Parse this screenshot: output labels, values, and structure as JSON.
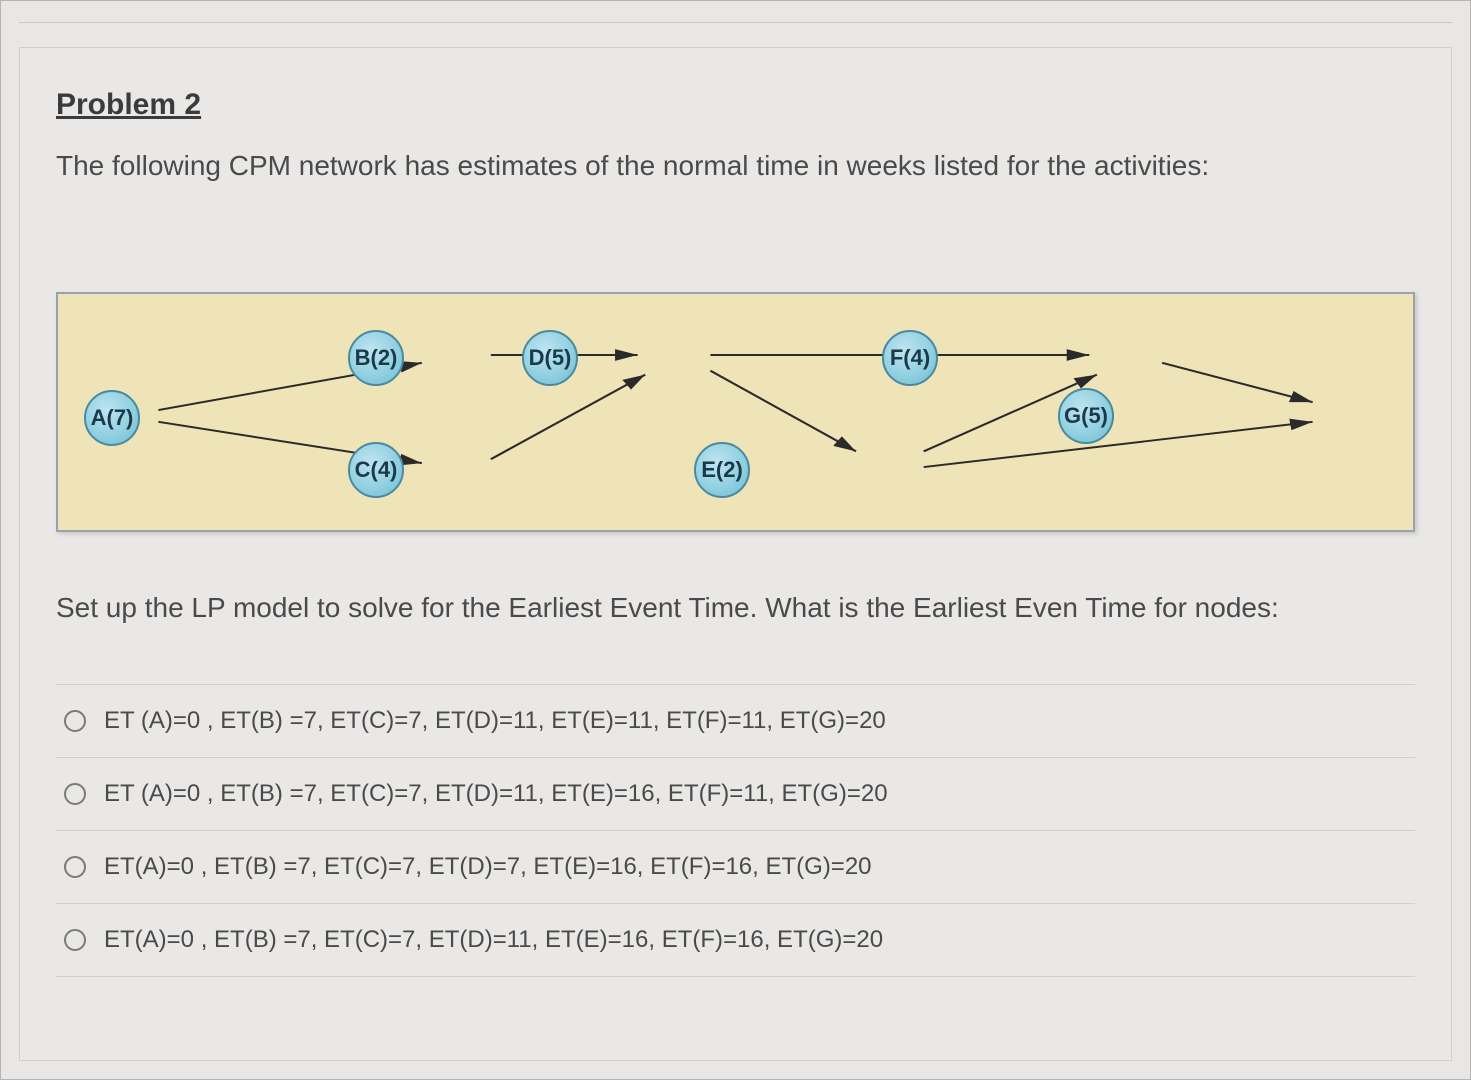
{
  "problem": {
    "title": "Problem 2",
    "intro": "The following CPM network has estimates of the normal time in weeks listed for the activities:",
    "question": "Set up the LP model to solve for the Earliest Event Time. What is the Earliest Even Time for nodes:"
  },
  "nodes": {
    "A": "A(7)",
    "B": "B(2)",
    "C": "C(4)",
    "D": "D(5)",
    "E": "E(2)",
    "F": "F(4)",
    "G": "G(5)"
  },
  "options": [
    "ET (A)=0 , ET(B) =7, ET(C)=7, ET(D)=11, ET(E)=11, ET(F)=11, ET(G)=20",
    "ET (A)=0 , ET(B) =7, ET(C)=7, ET(D)=11, ET(E)=16, ET(F)=11, ET(G)=20",
    "ET(A)=0 , ET(B) =7, ET(C)=7, ET(D)=7, ET(E)=16, ET(F)=16, ET(G)=20",
    "ET(A)=0 , ET(B) =7, ET(C)=7, ET(D)=11, ET(E)=16, ET(F)=16, ET(G)=20"
  ]
}
